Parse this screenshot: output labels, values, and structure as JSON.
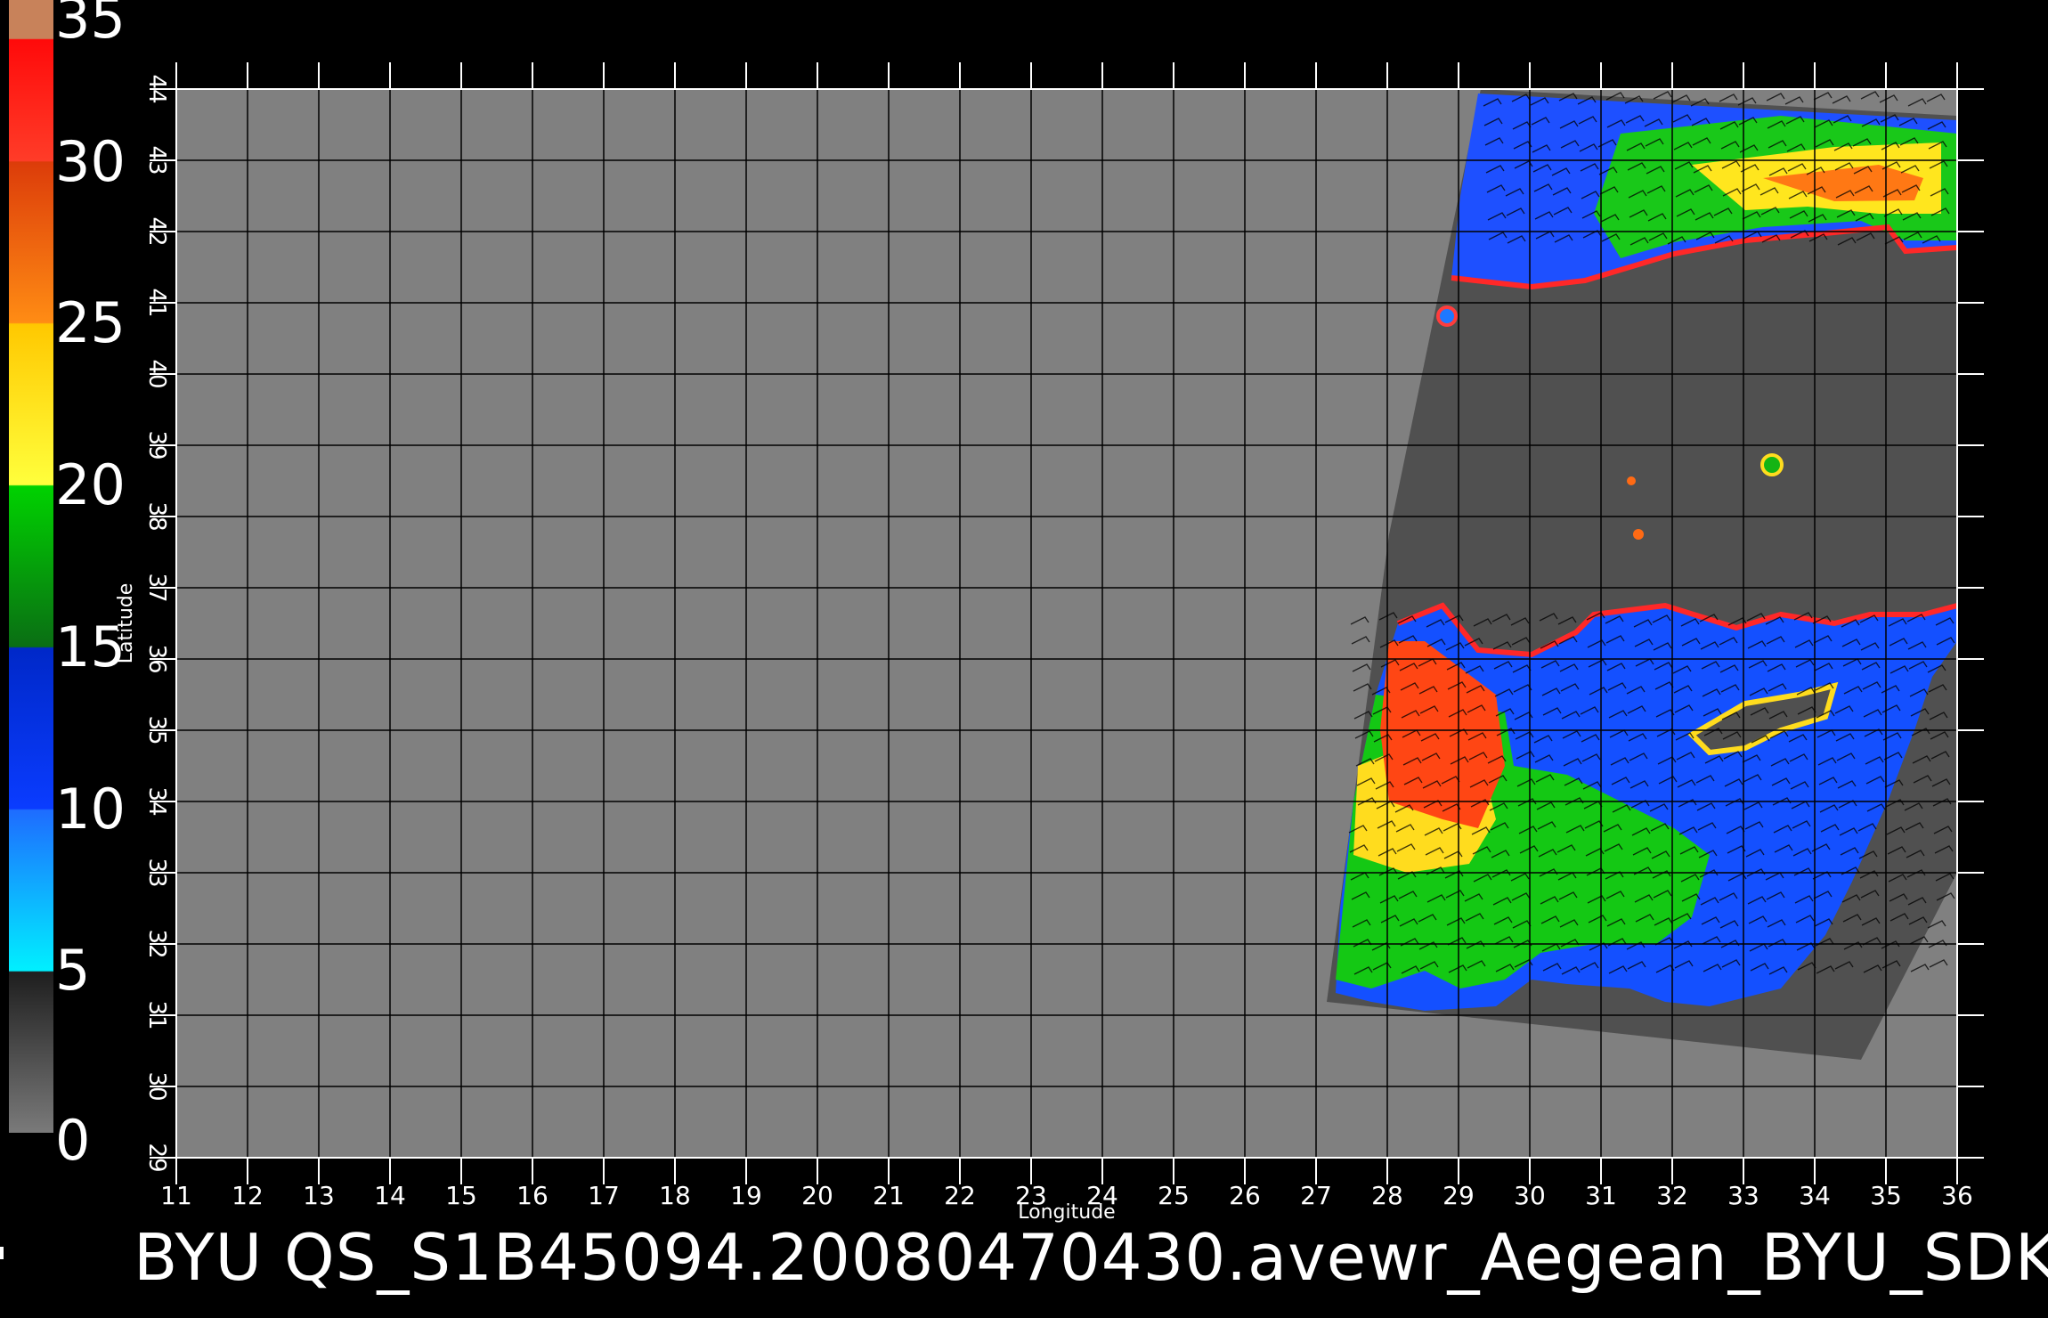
{
  "colorbar": {
    "labels": [
      "35",
      "30",
      "25",
      "20",
      "15",
      "10",
      "5",
      "0"
    ],
    "range": [
      0,
      35
    ],
    "segments": [
      {
        "from": 0,
        "to": 5,
        "color": "#7a7a7a"
      },
      {
        "from": 5,
        "to": 10,
        "color": "#00e6ff"
      },
      {
        "from": 10,
        "to": 15,
        "color": "#0044ff"
      },
      {
        "from": 15,
        "to": 20,
        "color": "#00c800"
      },
      {
        "from": 20,
        "to": 25,
        "color": "#ffee00"
      },
      {
        "from": 25,
        "to": 30,
        "color": "#ff7a00"
      },
      {
        "from": 30,
        "to": 35,
        "color": "#ff1e1e"
      }
    ]
  },
  "map": {
    "background_color": "#808080",
    "swath_color": "#505050",
    "grid_color": "#000000",
    "longitude": {
      "label": "Longitude",
      "min": 11,
      "max": 36,
      "ticks": [
        "11",
        "12",
        "13",
        "14",
        "15",
        "16",
        "17",
        "18",
        "19",
        "20",
        "21",
        "22",
        "23",
        "24",
        "25",
        "26",
        "27",
        "28",
        "29",
        "30",
        "31",
        "32",
        "33",
        "34",
        "35",
        "36"
      ]
    },
    "latitude": {
      "label": "Latitude",
      "min": 29,
      "max": 44,
      "ticks": [
        "29",
        "30",
        "31",
        "32",
        "33",
        "34",
        "35",
        "36",
        "37",
        "38",
        "39",
        "40",
        "41",
        "42",
        "43",
        "44"
      ]
    }
  },
  "title": "BYU  QS_S1B45094.20080470430.avewr_Aegean_BYU_SDK"
}
